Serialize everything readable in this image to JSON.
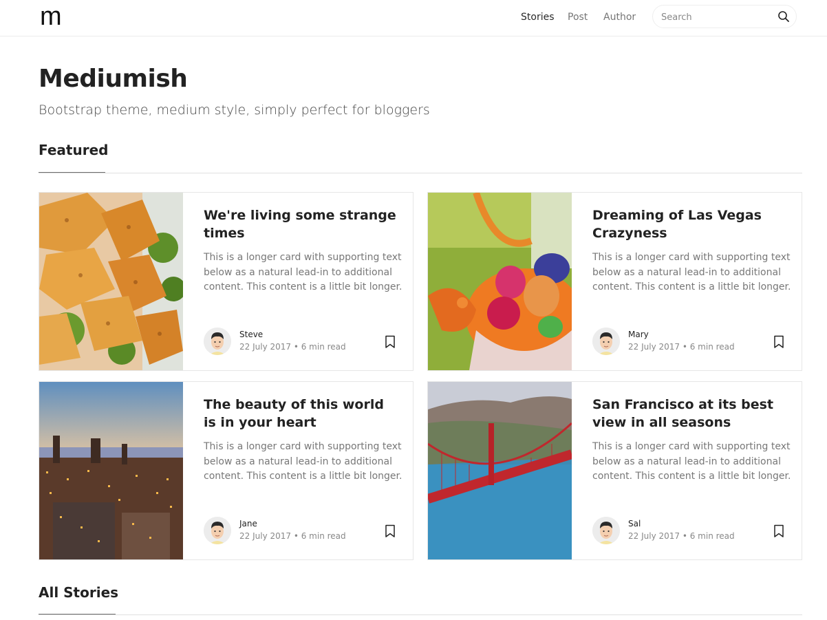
{
  "navbar": {
    "brand": "m",
    "links": [
      {
        "label": "Stories",
        "active": true
      },
      {
        "label": "Post",
        "active": false
      },
      {
        "label": "Author",
        "active": false
      }
    ],
    "search": {
      "placeholder": "Search",
      "value": "",
      "icon": "search-icon"
    }
  },
  "header": {
    "title": "Mediumish",
    "tagline": "Bootstrap theme, medium style, simply perfect for bloggers"
  },
  "featured": {
    "heading": "Featured",
    "cards": [
      {
        "title": "We're living some strange times",
        "text": "This is a longer card with supporting text below as a natural lead-in to additional content. This content is a little bit longer.",
        "author": "Steve",
        "meta": "22 July 2017 • 6 min read",
        "image": "food-salad-photo",
        "bookmark_icon": "bookmark-icon"
      },
      {
        "title": "Dreaming of Las Vegas Crazyness",
        "text": "This is a longer card with supporting text below as a natural lead-in to additional content. This content is a little bit longer.",
        "author": "Mary",
        "meta": "22 July 2017 • 6 min read",
        "image": "easter-basket-photo",
        "bookmark_icon": "bookmark-icon"
      },
      {
        "title": "The beauty of this world is in your heart",
        "text": "This is a longer card with supporting text below as a natural lead-in to additional content. This content is a little bit longer.",
        "author": "Jane",
        "meta": "22 July 2017 • 6 min read",
        "image": "city-sunset-photo",
        "bookmark_icon": "bookmark-icon"
      },
      {
        "title": "San Francisco at its best view in all seasons",
        "text": "This is a longer card with supporting text below as a natural lead-in to additional content. This content is a little bit longer.",
        "author": "Sal",
        "meta": "22 July 2017 • 6 min read",
        "image": "golden-gate-bridge-photo",
        "bookmark_icon": "bookmark-icon"
      }
    ]
  },
  "all_stories": {
    "heading": "All Stories"
  },
  "colors": {
    "text": "#222222",
    "muted": "#777777",
    "border": "#e6e6e6"
  }
}
